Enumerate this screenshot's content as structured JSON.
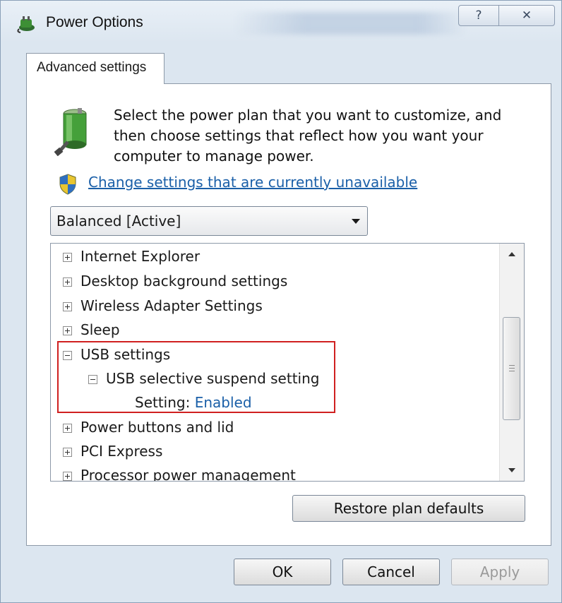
{
  "window": {
    "title": "Power Options",
    "help_glyph": "?",
    "close_glyph": "✕"
  },
  "tab": {
    "label": "Advanced settings"
  },
  "description": "Select the power plan that you want to customize, and then choose settings that reflect how you want your computer to manage power.",
  "change_link": "Change settings that are currently unavailable",
  "plan_select": {
    "value": "Balanced [Active]"
  },
  "tree": {
    "items": [
      {
        "label": "Internet Explorer",
        "expanded": false
      },
      {
        "label": "Desktop background settings",
        "expanded": false
      },
      {
        "label": "Wireless Adapter Settings",
        "expanded": false
      },
      {
        "label": "Sleep",
        "expanded": false
      },
      {
        "label": "USB settings",
        "expanded": true
      },
      {
        "label": "USB selective suspend setting",
        "expanded": true
      },
      {
        "label": "Setting:",
        "value": "Enabled"
      },
      {
        "label": "Power buttons and lid",
        "expanded": false
      },
      {
        "label": "PCI Express",
        "expanded": false
      },
      {
        "label": "Processor power management",
        "expanded": false
      }
    ]
  },
  "buttons": {
    "restore": "Restore plan defaults",
    "ok": "OK",
    "cancel": "Cancel",
    "apply": "Apply"
  },
  "colors": {
    "link": "#1a5fa8",
    "highlight_border": "#d02020"
  }
}
